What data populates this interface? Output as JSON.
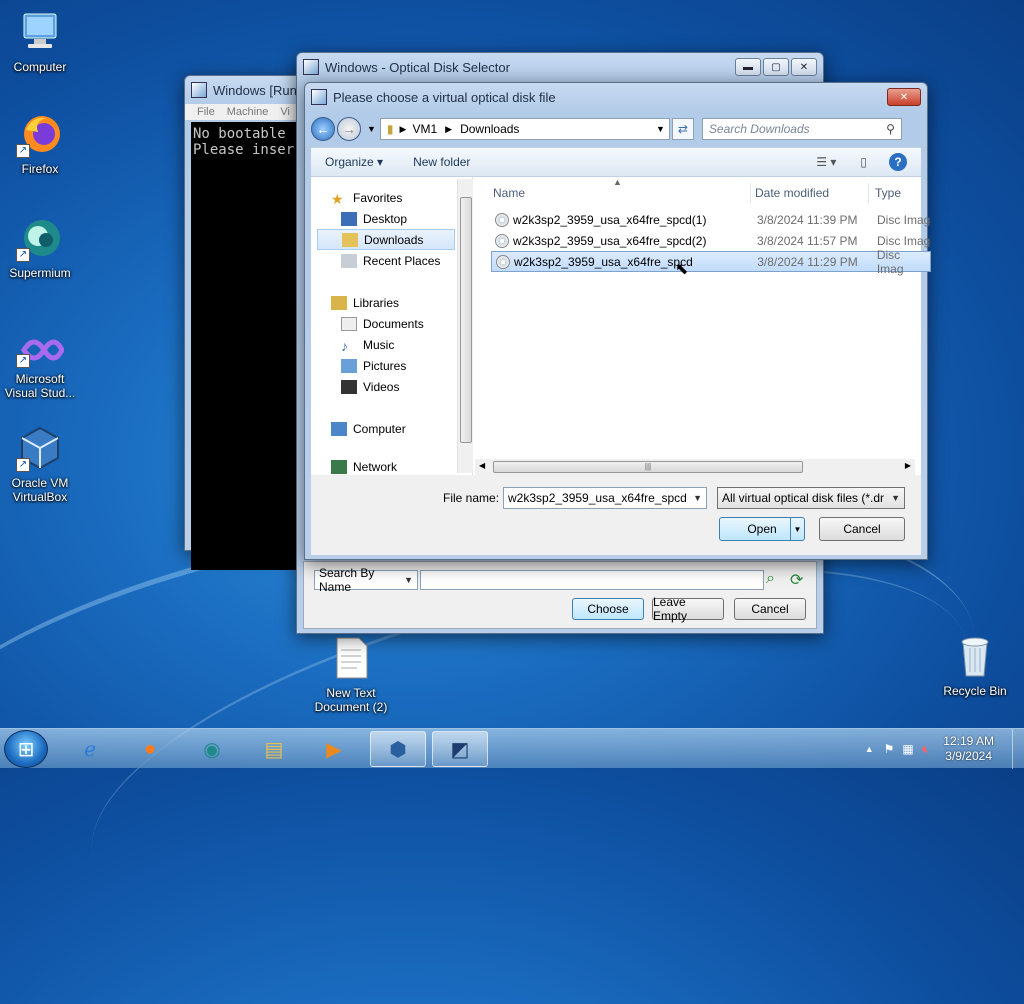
{
  "desktop": {
    "icons": [
      {
        "label": "Computer"
      },
      {
        "label": "Firefox"
      },
      {
        "label": "Supermium"
      },
      {
        "label": "Microsoft Visual Stud..."
      },
      {
        "label": "Oracle VM VirtualBox"
      },
      {
        "label": "New Text Document (2)"
      },
      {
        "label": "Recycle Bin"
      }
    ]
  },
  "vm_window": {
    "title": "Windows  [Runn",
    "menu": [
      "File",
      "Machine",
      "Vi"
    ],
    "console_lines": [
      "No bootable",
      "Please inser"
    ]
  },
  "selector_window": {
    "title": "Windows  - Optical Disk Selector",
    "search_mode": "Search By Name",
    "search_value": "",
    "buttons": {
      "choose": "Choose",
      "leave_empty": "Leave Empty",
      "cancel": "Cancel"
    }
  },
  "file_dialog": {
    "title": "Please choose a virtual optical disk file",
    "breadcrumb": [
      "VM1",
      "Downloads"
    ],
    "search_placeholder": "Search Downloads",
    "toolbar": {
      "organize": "Organize",
      "new_folder": "New folder"
    },
    "nav": {
      "favorites": "Favorites",
      "desktop": "Desktop",
      "downloads": "Downloads",
      "recent": "Recent Places",
      "libraries": "Libraries",
      "documents": "Documents",
      "music": "Music",
      "pictures": "Pictures",
      "videos": "Videos",
      "computer": "Computer",
      "network": "Network"
    },
    "columns": {
      "name": "Name",
      "date": "Date modified",
      "type": "Type"
    },
    "files": [
      {
        "name": "w2k3sp2_3959_usa_x64fre_spcd(1)",
        "date": "3/8/2024 11:39 PM",
        "type": "Disc Imag"
      },
      {
        "name": "w2k3sp2_3959_usa_x64fre_spcd(2)",
        "date": "3/8/2024 11:57 PM",
        "type": "Disc Imag"
      },
      {
        "name": "w2k3sp2_3959_usa_x64fre_spcd",
        "date": "3/8/2024 11:29 PM",
        "type": "Disc Imag"
      }
    ],
    "file_name_label": "File name:",
    "file_name_value": "w2k3sp2_3959_usa_x64fre_spcd",
    "file_type_value": "All virtual optical disk files (*.dr",
    "buttons": {
      "open": "Open",
      "cancel": "Cancel"
    }
  },
  "taskbar": {
    "clock_time": "12:19 AM",
    "clock_date": "3/9/2024"
  }
}
